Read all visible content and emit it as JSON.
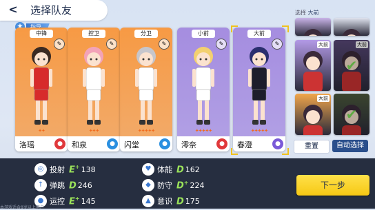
{
  "header": {
    "back_label": "<",
    "title": "选择队友"
  },
  "coach": {
    "label": "指导"
  },
  "cards": [
    {
      "position": "中锋",
      "name": "洛瑶",
      "badge_color": "#e0383b",
      "bg": "#f79a44",
      "jersey": "#d72b2b",
      "hair": "#3a2a22",
      "stars": "✦✦"
    },
    {
      "position": "控卫",
      "name": "和泉",
      "badge_color": "#2a8fe0",
      "bg": "#f79a44",
      "jersey": "#ffffff",
      "hair": "#f3a3b8",
      "stars": "✦✦✦"
    },
    {
      "position": "分卫",
      "name": "闪堂",
      "badge_color": "#2a8fe0",
      "bg": "#f79a44",
      "jersey": "#ffffff",
      "hair": "#c6c6cc",
      "stars": "✦✦✦✦✦"
    },
    {
      "position": "小前",
      "name": "澪奈",
      "badge_color": "#e0383b",
      "bg": "#a58de0",
      "jersey": "#ffffff",
      "hair": "#f3d070",
      "stars": "✦✦✦✦✦"
    },
    {
      "position": "大前",
      "name": "春澄",
      "badge_color": "#7a5ad8",
      "bg": "#a58de0",
      "jersey": "#1d1d2b",
      "hair": "#2a2f6e",
      "stars": "✦✦✦✦✦"
    }
  ],
  "right_panel": {
    "label_prefix": "选择",
    "label_value": "大前",
    "thumbs": [
      {
        "position": "",
        "bg": "#c9b4e8",
        "selected": false
      },
      {
        "position": "",
        "bg": "#dfe3ee",
        "selected": false
      },
      {
        "position": "大前",
        "bg": "#b39ae6",
        "selected": false
      },
      {
        "position": "大前",
        "bg": "#5b4a7c",
        "selected": true
      },
      {
        "position": "大前",
        "bg": "#f1a64b",
        "selected": false
      },
      {
        "position": "",
        "bg": "#4e5c3e",
        "selected": true
      }
    ],
    "reset_label": "重置",
    "auto_label": "自动选择"
  },
  "stats": [
    {
      "icon": "shoot-icon",
      "glyph": "◎",
      "label": "投射",
      "grade": "E",
      "plus": "+",
      "value": "138",
      "grade_color": "#9be35a"
    },
    {
      "icon": "physique-icon",
      "glyph": "♥",
      "label": "体能",
      "grade": "D",
      "plus": "",
      "value": "162",
      "grade_color": "#9be35a"
    },
    {
      "icon": "jump-icon",
      "glyph": "↑",
      "label": "弹跳",
      "grade": "D",
      "plus": "",
      "value": "246",
      "grade_color": "#9be35a"
    },
    {
      "icon": "defense-icon",
      "glyph": "◆",
      "label": "防守",
      "grade": "D",
      "plus": "+",
      "value": "224",
      "grade_color": "#9be35a"
    },
    {
      "icon": "dribble-icon",
      "glyph": "●",
      "label": "运控",
      "grade": "E",
      "plus": "+",
      "value": "145",
      "grade_color": "#9be35a"
    },
    {
      "icon": "awareness-icon",
      "glyph": "▲",
      "label": "意识",
      "grade": "D",
      "plus": "",
      "value": "175",
      "grade_color": "#9be35a"
    }
  ],
  "next_button": {
    "label": "下一步"
  },
  "footer_text": "本游戏适合8岁以上用户"
}
